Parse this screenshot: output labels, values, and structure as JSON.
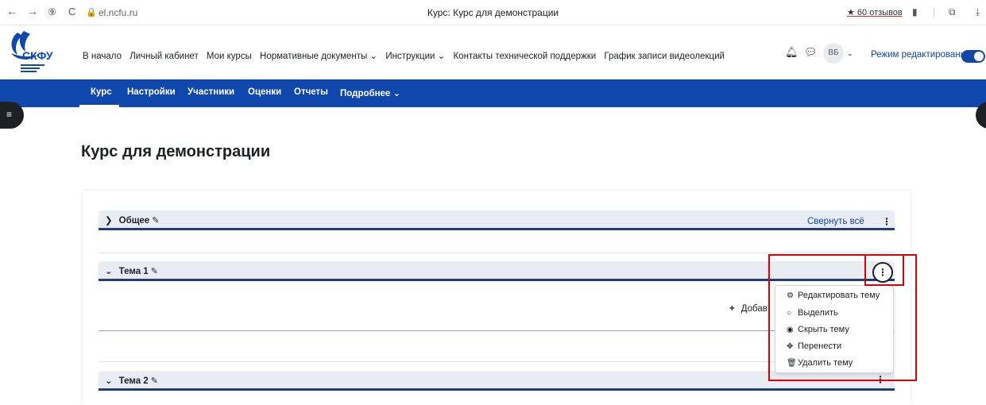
{
  "browser": {
    "back": "←",
    "forward": "→",
    "reload": "C",
    "url": "el.ncfu.ru",
    "title": "Курс: Курс для демонстрации",
    "reviews": "★ 60 отзывов"
  },
  "header": {
    "logo_text": "СКФУ",
    "nav": [
      {
        "label": "В начало"
      },
      {
        "label": "Личный кабинет"
      },
      {
        "label": "Мои курсы"
      },
      {
        "label": "Нормативные документы ⌄"
      },
      {
        "label": "Инструкции ⌄"
      },
      {
        "label": "Контакты технической поддержки"
      },
      {
        "label": "График записи видеолекций"
      }
    ],
    "avatar_initials": "ВБ",
    "edit_mode_label": "Режим редактирования",
    "edit_mode_on": true
  },
  "secondary_nav": {
    "items": [
      {
        "label": "Курс",
        "active": true
      },
      {
        "label": "Настройки"
      },
      {
        "label": "Участники"
      },
      {
        "label": "Оценки"
      },
      {
        "label": "Отчеты"
      },
      {
        "label": "Подробнее ⌄"
      }
    ]
  },
  "course": {
    "title": "Курс для демонстрации",
    "collapse_all": "Свернуть всё",
    "sections": [
      {
        "name": "Общее",
        "expanded": false
      },
      {
        "name": "Тема 1",
        "expanded": true
      },
      {
        "name": "Тема 2",
        "expanded": true
      }
    ],
    "add_activity_label": "Добав"
  },
  "section_menu": {
    "items": [
      {
        "icon": "gear-icon",
        "label": "Редактировать тему"
      },
      {
        "icon": "circle-icon",
        "label": "Выделить"
      },
      {
        "icon": "eye-icon",
        "label": "Скрыть тему"
      },
      {
        "icon": "move-icon",
        "label": "Перенести"
      },
      {
        "icon": "trash-icon",
        "label": "Удалить тему"
      }
    ]
  },
  "colors": {
    "brand_blue": "#0f47ad",
    "highlight_red": "#e00000",
    "section_bar": "#e9ecf3"
  }
}
